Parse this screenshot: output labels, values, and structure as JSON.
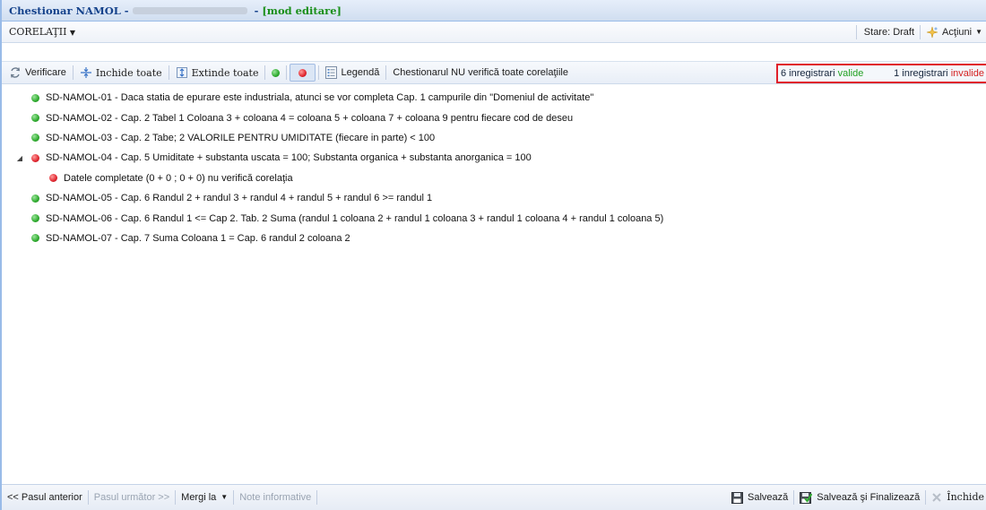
{
  "window": {
    "title_prefix": "Chestionar NAMOL -",
    "title_mode": "[mod editare]"
  },
  "menubar": {
    "corelatii_label": "CORELAŢII",
    "stare_label": "Stare: Draft",
    "actiuni_label": "Acţiuni"
  },
  "toolbar": {
    "verificare_label": "Verificare",
    "inchide_toate_label": "Inchide toate",
    "extinde_toate_label": "Extinde toate",
    "legenda_label": "Legendă",
    "status_text": "Chestionarul NU verifică toate corelaţiile",
    "valid_count": "6 inregistrari",
    "valid_word": "valide",
    "invalid_count": "1 inregistrari",
    "invalid_word": "invalide"
  },
  "correlations": [
    {
      "status": "green",
      "text": "SD-NAMOL-01 - Daca statia de epurare este industriala, atunci se vor completa Cap. 1 campurile din \"Domeniul de activitate\""
    },
    {
      "status": "green",
      "text": "SD-NAMOL-02 - Cap. 2 Tabel 1 Coloana 3 + coloana 4 = coloana 5 + coloana 7 + coloana 9 pentru fiecare cod de deseu"
    },
    {
      "status": "green",
      "text": "SD-NAMOL-03 - Cap. 2 Tabe; 2 VALORILE PENTRU UMIDITATE (fiecare in parte) < 100"
    },
    {
      "status": "red",
      "text": "SD-NAMOL-04 - Cap. 5 Umiditate + substanta uscata = 100; Substanta organica + substanta anorganica = 100"
    },
    {
      "status": "red",
      "text": "Datele completate (0 + 0 ; 0 + 0) nu verifică corelaţia"
    },
    {
      "status": "green",
      "text": "SD-NAMOL-05 - Cap. 6 Randul 2 + randul 3 + randul 4 + randul 5 + randul 6 >= randul 1"
    },
    {
      "status": "green",
      "text": "SD-NAMOL-06 - Cap. 6 Randul 1 <= Cap 2. Tab. 2 Suma (randul 1 coloana 2 + randul 1 coloana 3 + randul 1 coloana 4 + randul 1 coloana 5)"
    },
    {
      "status": "green",
      "text": "SD-NAMOL-07 - Cap. 7 Suma Coloana 1 = Cap. 6 randul 2 coloana 2"
    }
  ],
  "bottombar": {
    "pasul_anterior": "<< Pasul anterior",
    "pasul_urmator": "Pasul următor >>",
    "mergi_la": "Mergi la",
    "note_informative": "Note informative",
    "salveaza": "Salvează",
    "salveaza_finalizeaza": "Salvează şi Finalizează",
    "inchide": "Închide"
  },
  "colors": {
    "ok": "#2eaa2e",
    "error": "#e0262f",
    "highlight_box": "#e0202b",
    "title_mode": "#1a8f1a"
  }
}
